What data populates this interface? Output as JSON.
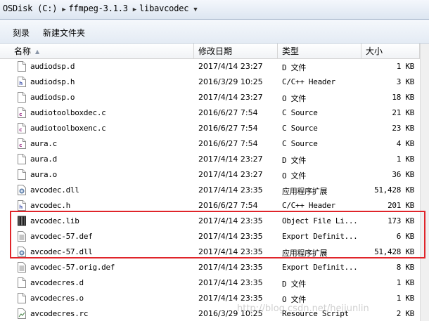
{
  "address": {
    "crumbs": [
      "OSDisk (C:)",
      "ffmpeg-3.1.3",
      "libavcodec"
    ]
  },
  "toolbar": {
    "burn_label": "刻录",
    "new_folder_label": "新建文件夹"
  },
  "columns": {
    "name": "名称",
    "date": "修改日期",
    "type": "类型",
    "size": "大小"
  },
  "files": [
    {
      "name": "audiodsp.d",
      "date": "2017/4/14 23:27",
      "type": "D 文件",
      "size": "1 KB",
      "icon": "blank-file-icon"
    },
    {
      "name": "audiodsp.h",
      "date": "2016/3/29 10:25",
      "type": "C/C++ Header",
      "size": "3 KB",
      "icon": "header-file-icon"
    },
    {
      "name": "audiodsp.o",
      "date": "2017/4/14 23:27",
      "type": "O 文件",
      "size": "18 KB",
      "icon": "blank-file-icon"
    },
    {
      "name": "audiotoolboxdec.c",
      "date": "2016/6/27 7:54",
      "type": "C Source",
      "size": "21 KB",
      "icon": "c-source-icon"
    },
    {
      "name": "audiotoolboxenc.c",
      "date": "2016/6/27 7:54",
      "type": "C Source",
      "size": "23 KB",
      "icon": "c-source-icon"
    },
    {
      "name": "aura.c",
      "date": "2016/6/27 7:54",
      "type": "C Source",
      "size": "4 KB",
      "icon": "c-source-icon"
    },
    {
      "name": "aura.d",
      "date": "2017/4/14 23:27",
      "type": "D 文件",
      "size": "1 KB",
      "icon": "blank-file-icon"
    },
    {
      "name": "aura.o",
      "date": "2017/4/14 23:27",
      "type": "O 文件",
      "size": "36 KB",
      "icon": "blank-file-icon"
    },
    {
      "name": "avcodec.dll",
      "date": "2017/4/14 23:35",
      "type": "应用程序扩展",
      "size": "51,428 KB",
      "icon": "dll-gear-icon"
    },
    {
      "name": "avcodec.h",
      "date": "2016/6/27 7:54",
      "type": "C/C++ Header",
      "size": "201 KB",
      "icon": "header-file-icon"
    },
    {
      "name": "avcodec.lib",
      "date": "2017/4/14 23:35",
      "type": "Object File Li...",
      "size": "173 KB",
      "icon": "library-file-icon"
    },
    {
      "name": "avcodec-57.def",
      "date": "2017/4/14 23:35",
      "type": "Export Definit...",
      "size": "6 KB",
      "icon": "text-file-icon"
    },
    {
      "name": "avcodec-57.dll",
      "date": "2017/4/14 23:35",
      "type": "应用程序扩展",
      "size": "51,428 KB",
      "icon": "dll-gear-icon"
    },
    {
      "name": "avcodec-57.orig.def",
      "date": "2017/4/14 23:35",
      "type": "Export Definit...",
      "size": "8 KB",
      "icon": "text-file-icon"
    },
    {
      "name": "avcodecres.d",
      "date": "2017/4/14 23:35",
      "type": "D 文件",
      "size": "1 KB",
      "icon": "blank-file-icon"
    },
    {
      "name": "avcodecres.o",
      "date": "2017/4/14 23:35",
      "type": "O 文件",
      "size": "1 KB",
      "icon": "blank-file-icon"
    },
    {
      "name": "avcodecres.rc",
      "date": "2016/3/29 10:25",
      "type": "Resource Script",
      "size": "2 KB",
      "icon": "resource-script-icon"
    }
  ],
  "watermark": "http://blog.csdn.net/hejjunlin",
  "colors": {
    "highlight": "#e0252a",
    "c_source": "#9b2f86",
    "header": "#4a5cb0"
  }
}
